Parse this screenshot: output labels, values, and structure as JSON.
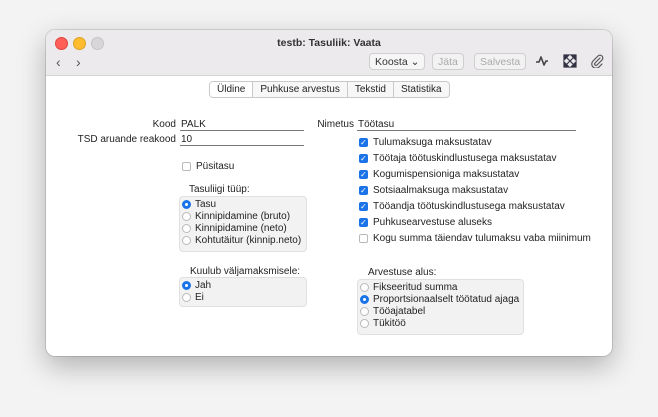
{
  "window": {
    "title": "testb: Tasuliik: Vaata"
  },
  "toolbar": {
    "back": "‹",
    "forward": "›",
    "koosta": "Koosta ⌄",
    "jata": "Jäta",
    "salvesta": "Salvesta"
  },
  "tabs": [
    "Üldine",
    "Puhkuse arvestus",
    "Tekstid",
    "Statistika"
  ],
  "form": {
    "kood_label": "Kood",
    "kood_value": "PALK",
    "tsd_label": "TSD aruande reakood",
    "tsd_value": "10",
    "nimetus_label": "Nimetus",
    "nimetus_value": "Töötasu",
    "pusitasu_label": "Püsitasu"
  },
  "checkboxes": [
    {
      "label": "Tulumaksuga maksustatav",
      "checked": true
    },
    {
      "label": "Töötaja töötuskindlustusega maksustatav",
      "checked": true
    },
    {
      "label": "Kogumispensioniga maksustatav",
      "checked": true
    },
    {
      "label": "Sotsiaalmaksuga maksustatav",
      "checked": true
    },
    {
      "label": "Tööandja töötuskindlustusega maksustatav",
      "checked": true
    },
    {
      "label": "Puhkusearvestuse aluseks",
      "checked": true
    },
    {
      "label": "Kogu summa täiendav tulumaksu vaba miinimum",
      "checked": false
    }
  ],
  "tasuliigi_tyyp": {
    "title": "Tasuliigi tüüp:",
    "options": [
      "Tasu",
      "Kinnipidamine (bruto)",
      "Kinnipidamine (neto)",
      "Kohtutäitur (kinnip.neto)"
    ],
    "selected": 0
  },
  "kuulub": {
    "title": "Kuulub väljamaksmisele:",
    "options": [
      "Jah",
      "Ei"
    ],
    "selected": 0
  },
  "arvestuse_alus": {
    "title": "Arvestuse alus:",
    "options": [
      "Fikseeritud summa",
      "Proportsionaalselt töötatud ajaga",
      "Tööajatabel",
      "Tükitöö"
    ],
    "selected": 1
  },
  "colors": {
    "accent": "#1a73e8"
  },
  "icons": [
    "activity-icon",
    "expand-icon",
    "paperclip-icon"
  ]
}
